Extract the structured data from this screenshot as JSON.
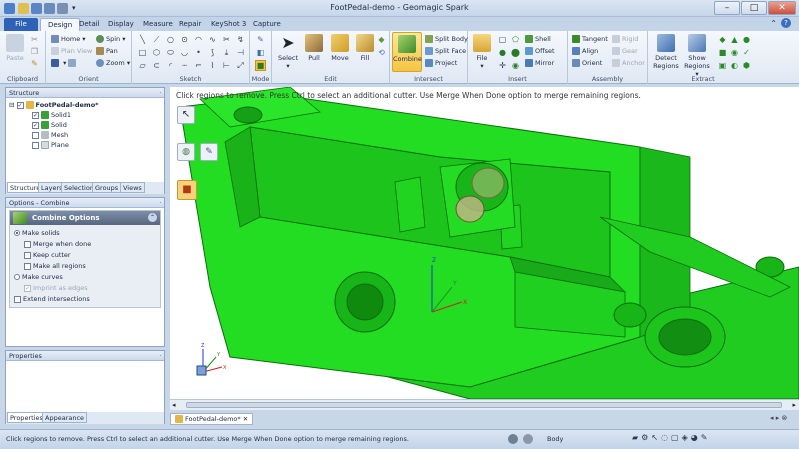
{
  "window": {
    "title": "FootPedal-demo - Geomagic Spark",
    "controls": [
      "–",
      "□",
      "✕"
    ]
  },
  "tabs": [
    "File",
    "Design",
    "Detail",
    "Display",
    "Measure",
    "Repair",
    "KeyShot 3",
    "Capture"
  ],
  "ribbon": {
    "groups": [
      "Clipboard",
      "Orient",
      "Sketch",
      "Mode",
      "Edit",
      "Intersect",
      "Insert",
      "Assembly",
      "Extract"
    ],
    "clipboard": {
      "paste": "Paste"
    },
    "orient": {
      "home": "Home",
      "spin": "Spin",
      "plan_view": "Plan View",
      "pan": "Pan",
      "zoom": "Zoom"
    },
    "edit": {
      "select": "Select",
      "pull": "Pull",
      "move": "Move",
      "fill": "Fill"
    },
    "intersect": {
      "combine": "Combine",
      "split_body": "Split Body",
      "split_face": "Split Face",
      "project": "Project"
    },
    "insert": {
      "file": "File",
      "shell": "Shell",
      "offset": "Offset",
      "mirror": "Mirror"
    },
    "assembly": {
      "tangent": "Tangent",
      "align": "Align",
      "orient": "Orient",
      "rigid": "Rigid",
      "gear": "Gear",
      "anchor": "Anchor"
    },
    "extract": {
      "detect_regions": "Detect Regions",
      "show_regions": "Show Regions"
    }
  },
  "structure": {
    "title": "Structure",
    "items": [
      {
        "label": "FootPedal-demo*",
        "checked": true,
        "level": 0
      },
      {
        "label": "Solid1",
        "checked": true,
        "level": 1
      },
      {
        "label": "Solid",
        "checked": true,
        "level": 1
      },
      {
        "label": "Mesh",
        "checked": false,
        "level": 1
      },
      {
        "label": "Plane",
        "checked": false,
        "level": 1
      }
    ],
    "tabs": [
      "Structure",
      "Layers",
      "Selection",
      "Groups",
      "Views"
    ]
  },
  "options": {
    "title": "Options - Combine",
    "header": "Combine Options",
    "make_solids": "Make solids",
    "merge_when_done": "Merge when done",
    "keep_cutter": "Keep cutter",
    "make_all_regions": "Make all regions",
    "make_curves": "Make curves",
    "imprint_as_edges": "Imprint as edges",
    "extend_intersections": "Extend intersections"
  },
  "properties": {
    "title": "Properties",
    "tabs": [
      "Properties",
      "Appearance"
    ]
  },
  "viewport": {
    "hint": "Click regions to remove. Press Ctrl to select an additional cutter. Use Merge When Done option to merge remaining regions.",
    "axis_labels": [
      "Z",
      "Y",
      "X"
    ],
    "model_color": "#22dd22"
  },
  "document_tab": "FootPedal-demo*",
  "status": {
    "message": "Click regions to remove. Press Ctrl to select an additional cutter. Use Merge When Done option to merge remaining regions.",
    "selection_type": "Body"
  }
}
